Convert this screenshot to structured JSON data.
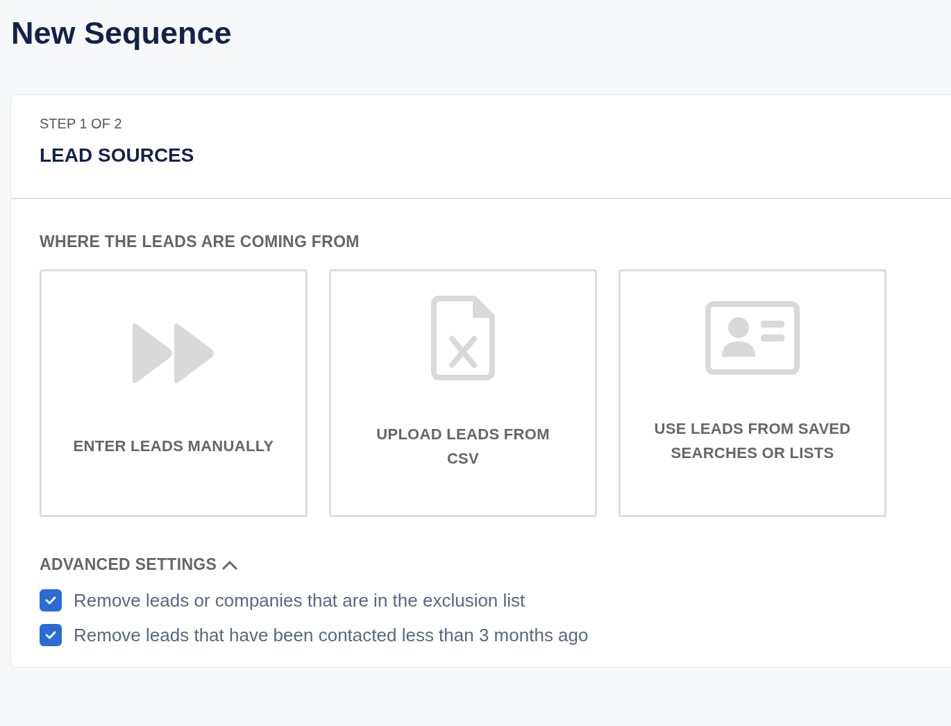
{
  "page": {
    "title": "New Sequence"
  },
  "step": {
    "label": "STEP 1 OF 2",
    "title": "LEAD SOURCES"
  },
  "section_label": "WHERE THE LEADS ARE COMING FROM",
  "sources": [
    {
      "kind": "manual",
      "label": "ENTER LEADS MANUALLY",
      "selected": false
    },
    {
      "kind": "csv",
      "label": "UPLOAD LEADS FROM CSV",
      "selected": false
    },
    {
      "kind": "saved",
      "label": "USE LEADS FROM SAVED SEARCHES OR LISTS",
      "selected": false
    }
  ],
  "advanced": {
    "label": "ADVANCED SETTINGS",
    "expanded": true
  },
  "options": [
    {
      "label": "Remove leads or companies that are in the exclusion list",
      "checked": true
    },
    {
      "label": "Remove leads that have been contacted less than 3 months ago",
      "checked": true
    }
  ]
}
